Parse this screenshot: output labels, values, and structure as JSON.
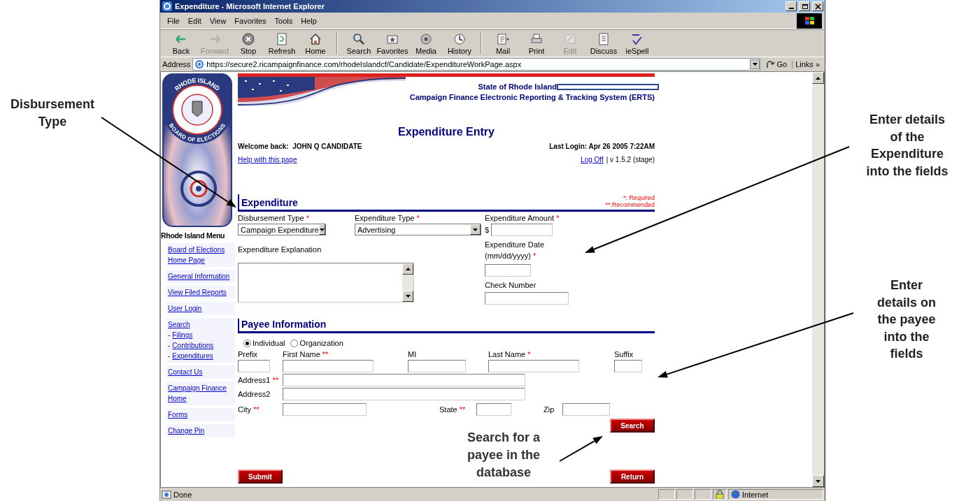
{
  "window": {
    "title": "Expenditure - Microsoft Internet Explorer"
  },
  "menu_bar": [
    "File",
    "Edit",
    "View",
    "Favorites",
    "Tools",
    "Help"
  ],
  "toolbar": [
    {
      "kind": "back",
      "label": "Back",
      "disabled": false
    },
    {
      "kind": "forward",
      "label": "Forward",
      "disabled": true
    },
    {
      "kind": "stop",
      "label": "Stop",
      "disabled": false
    },
    {
      "kind": "refresh",
      "label": "Refresh",
      "disabled": false
    },
    {
      "kind": "home",
      "label": "Home",
      "disabled": false
    },
    {
      "kind": "search",
      "label": "Search",
      "disabled": false
    },
    {
      "kind": "favorites",
      "label": "Favorites",
      "disabled": false
    },
    {
      "kind": "media",
      "label": "Media",
      "disabled": false
    },
    {
      "kind": "history",
      "label": "History",
      "disabled": false
    },
    {
      "kind": "mail",
      "label": "Mail",
      "disabled": false
    },
    {
      "kind": "print",
      "label": "Print",
      "disabled": false
    },
    {
      "kind": "edit",
      "label": "Edit",
      "disabled": true
    },
    {
      "kind": "discuss",
      "label": "Discuss",
      "disabled": false
    },
    {
      "kind": "spell",
      "label": "ieSpell",
      "disabled": false
    }
  ],
  "address_bar": {
    "label": "Address",
    "url": "https://secure2.ricampaignfinance.com/rhodeIslandcf/Candidate/ExpenditureWorkPage.aspx",
    "go": "Go",
    "links": "Links »"
  },
  "page": {
    "logo_top": "RHODE ISLAND",
    "logo_bottom": "BOARD OF ELECTIONS",
    "state": "State of Rhode Island",
    "system": "Campaign Finance Electronic Reporting & Tracking System (ERTS)",
    "title": "Expenditure Entry",
    "welcome": "Welcome back:  JOHN Q CANDIDATE",
    "last_login": "Last Login: Apr 26 2005 7:22AM",
    "help_link": "Help with this page",
    "log_off": "Log Off",
    "version": "| v 1.5.2 (stage)"
  },
  "sidebar": {
    "title": "Rhode Island Menu",
    "items": [
      {
        "label": "Board of Elections Home Page"
      },
      {
        "label": "General Information"
      },
      {
        "label": "View Filed Reports"
      },
      {
        "label": "User Login"
      },
      {
        "label": "Search",
        "children": [
          {
            "bullet": "-",
            "label": "Filings"
          },
          {
            "bullet": "-",
            "label": "Contributions"
          },
          {
            "bullet": "-",
            "label": "Expenditures"
          }
        ]
      },
      {
        "label": "Contact Us"
      },
      {
        "label": "Campaign Finance Home"
      },
      {
        "label": "Forms"
      },
      {
        "label": "Change Pin"
      }
    ]
  },
  "expenditure": {
    "heading": "Expenditure",
    "legend_required": "*: Required",
    "legend_recommended": "**:Recommended",
    "disbursement_type": {
      "label": "Disbursement Type",
      "required": "*",
      "value": "Campaign Expenditure"
    },
    "expenditure_type": {
      "label": "Expenditure Type",
      "required": "*",
      "value": "Advertising"
    },
    "amount": {
      "label": "Expenditure Amount",
      "required": "*",
      "prefix": "$"
    },
    "explanation": {
      "label": "Expenditure Explanation"
    },
    "date": {
      "label": "Expenditure Date",
      "format": "(mm/dd/yyyy)",
      "required": "*"
    },
    "check_number": {
      "label": "Check Number"
    }
  },
  "payee": {
    "heading": "Payee Information",
    "radios": [
      {
        "label": "Individual",
        "selected": true
      },
      {
        "label": "Organization",
        "selected": false
      }
    ],
    "name_fields": [
      {
        "label": "Prefix"
      },
      {
        "label": "First Name",
        "required": "**"
      },
      {
        "label": "MI"
      },
      {
        "label": "Last Name",
        "required": "*"
      },
      {
        "label": "Suffix"
      }
    ],
    "address1": {
      "label": "Address1",
      "required": "**"
    },
    "address2": {
      "label": "Address2"
    },
    "city": {
      "label": "City",
      "required": "**"
    },
    "state": {
      "label": "State",
      "required": "**"
    },
    "zip": {
      "label": "Zip"
    },
    "search_button": "Search"
  },
  "buttons": {
    "submit": "Submit",
    "return": "Return"
  },
  "status_bar": {
    "text": "Done",
    "zone": "Internet"
  },
  "callouts": {
    "disbursement": "Disbursement Type",
    "expenditure": "Enter details of the Expenditure into the fields",
    "payee": "Enter details on the payee into the fields",
    "search": "Search for a payee in the database"
  }
}
